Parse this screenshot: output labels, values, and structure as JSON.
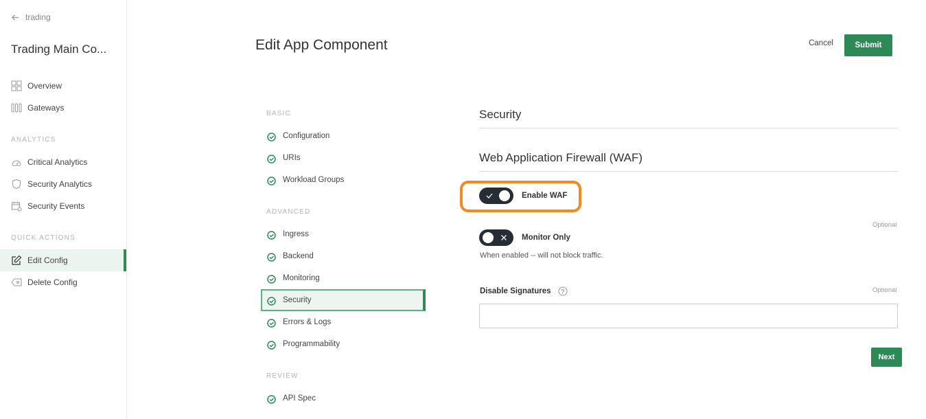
{
  "sidebar": {
    "back_label": "trading",
    "app_title": "Trading Main Co...",
    "items": [
      {
        "label": "Overview",
        "icon": "grid-icon"
      },
      {
        "label": "Gateways",
        "icon": "gateway-icon"
      }
    ],
    "analytics_section": "ANALYTICS",
    "analytics_items": [
      {
        "label": "Critical Analytics",
        "icon": "gauge-icon"
      },
      {
        "label": "Security Analytics",
        "icon": "shield-icon"
      },
      {
        "label": "Security Events",
        "icon": "calendar-icon"
      }
    ],
    "quick_actions_section": "QUICK ACTIONS",
    "quick_actions": [
      {
        "label": "Edit Config",
        "icon": "edit-icon",
        "active": true
      },
      {
        "label": "Delete Config",
        "icon": "delete-icon",
        "active": false
      }
    ]
  },
  "header": {
    "title": "Edit App Component",
    "cancel_label": "Cancel",
    "submit_label": "Submit"
  },
  "steps": {
    "basic_section": "BASIC",
    "basic": [
      "Configuration",
      "URIs",
      "Workload Groups"
    ],
    "advanced_section": "ADVANCED",
    "advanced": [
      "Ingress",
      "Backend",
      "Monitoring",
      "Security",
      "Errors & Logs",
      "Programmability"
    ],
    "review_section": "REVIEW",
    "review": [
      "API Spec"
    ],
    "active_step": "Security"
  },
  "content": {
    "section_title": "Security",
    "subsection_title": "Web Application Firewall (WAF)",
    "enable_waf": {
      "label": "Enable WAF",
      "on": true
    },
    "monitor_only": {
      "label": "Monitor Only",
      "on": false,
      "optional": "Optional",
      "helper": "When enabled -- will not block traffic."
    },
    "disable_signatures": {
      "label": "Disable Signatures",
      "optional": "Optional",
      "value": "",
      "placeholder": ""
    },
    "next_label": "Next"
  },
  "colors": {
    "accent": "#2d8a56",
    "highlight": "#f28a1d",
    "toggle": "#262d35"
  }
}
